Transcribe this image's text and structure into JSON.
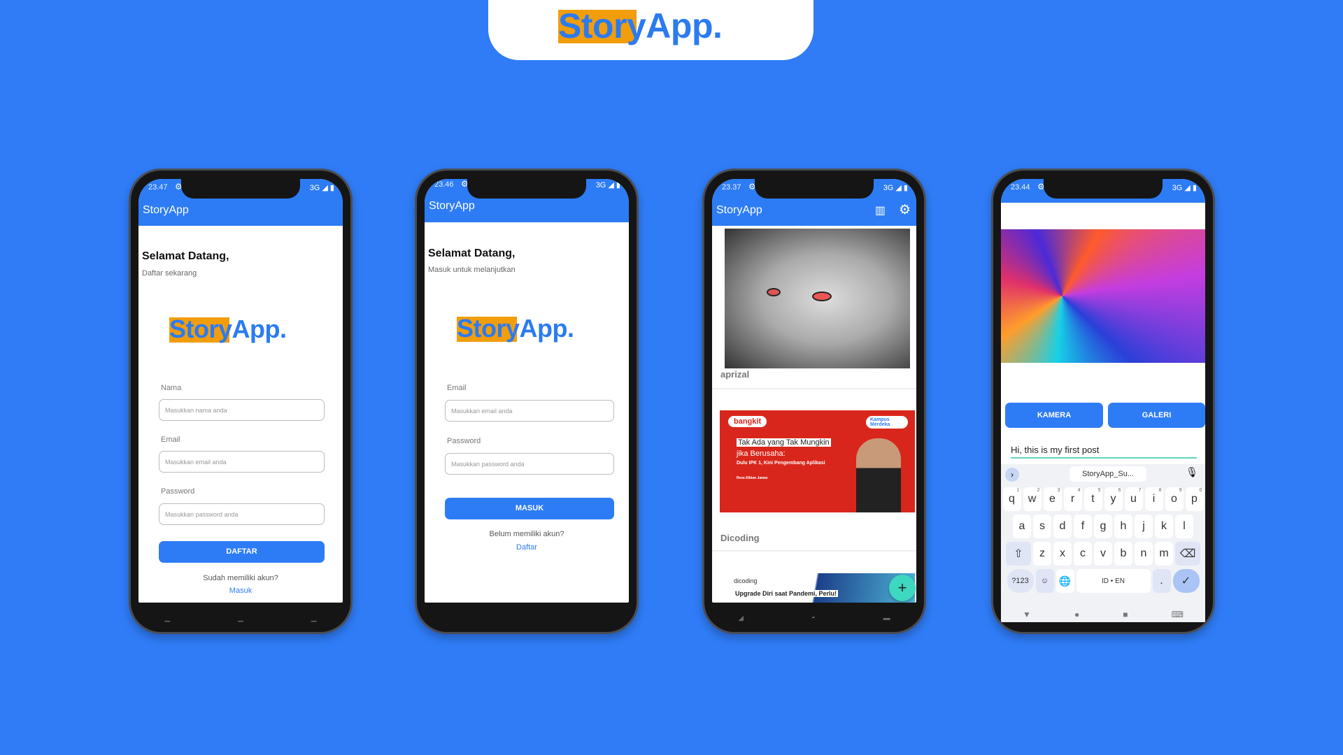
{
  "brand": {
    "logo_text": "StoryApp.",
    "logo_highlight": "Sto",
    "logo_rest": "ryApp.",
    "colors": {
      "background": "#2f7cf6",
      "primary": "#2d7cf5",
      "accent": "#f29d0c",
      "fab": "#3ed7c0"
    }
  },
  "phones": [
    {
      "status_time": "23.47",
      "status_right": "3G ◢ ▮",
      "app_title": "StoryApp",
      "greeting": "Selamat Datang,",
      "subtitle": "Daftar sekarang",
      "fields": [
        {
          "label": "Nama",
          "placeholder": "Masukkan nama anda"
        },
        {
          "label": "Email",
          "placeholder": "Masukkan email anda"
        },
        {
          "label": "Password",
          "placeholder": "Masukkan password anda"
        }
      ],
      "button": "DAFTAR",
      "prompt": "Sudah memiliki akun?",
      "link": "Masuk"
    },
    {
      "status_time": "23.46",
      "status_right": "3G ◢ ▮",
      "app_title": "StoryApp",
      "greeting": "Selamat Datang,",
      "subtitle": "Masuk untuk melanjutkan",
      "fields": [
        {
          "label": "Email",
          "placeholder": "Masukkan email anda"
        },
        {
          "label": "Password",
          "placeholder": "Masukkan password anda"
        }
      ],
      "button": "MASUK",
      "prompt": "Belum memiliki akun?",
      "link": "Daftar"
    },
    {
      "status_time": "23.37",
      "status_right": "3G ◢ ▮",
      "app_title": "StoryApp",
      "stories": [
        {
          "name": "aprizal"
        },
        {
          "name": "Dicoding",
          "banner": {
            "brand": "bangkit",
            "partner": "Kampus Merdeka",
            "headline": "Tak Ada yang Tak Mungkin",
            "headline2": "jika Berusaha:",
            "subline": "Dulu IPK 1, Kini Pengembang Aplikasi",
            "person": "Reza Albian Jawas"
          }
        },
        {
          "banner": {
            "brand": "dicoding",
            "headline": "Upgrade Diri saat Pandemi, Perlu!"
          }
        }
      ],
      "fab": "+"
    },
    {
      "status_time": "23.44",
      "status_right": "3G ◢ ▮",
      "camera_button": "KAMERA",
      "gallery_button": "GALERI",
      "description": "Hi, this is my first post",
      "clipboard": "StoryApp_Su...",
      "keyboard": {
        "row1": [
          "q",
          "w",
          "e",
          "r",
          "t",
          "y",
          "u",
          "i",
          "o",
          "p"
        ],
        "row1_hints": [
          "1",
          "2",
          "3",
          "4",
          "5",
          "6",
          "7",
          "8",
          "9",
          "0"
        ],
        "row2": [
          "a",
          "s",
          "d",
          "f",
          "g",
          "h",
          "j",
          "k",
          "l"
        ],
        "row3": [
          "z",
          "x",
          "c",
          "v",
          "b",
          "n",
          "m"
        ],
        "symbols": "?123",
        "space": "ID • EN",
        "period": "."
      }
    }
  ]
}
